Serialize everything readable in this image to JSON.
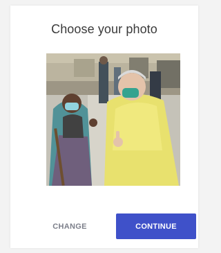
{
  "dialog": {
    "title": "Choose your photo",
    "change_label": "CHANGE",
    "continue_label": "CONTINUE"
  },
  "colors": {
    "accent": "#3f51c9",
    "change_text": "#7c7f8a",
    "title_text": "#3a3a3a",
    "card_bg": "#ffffff",
    "page_bg": "#f3f3f3"
  }
}
